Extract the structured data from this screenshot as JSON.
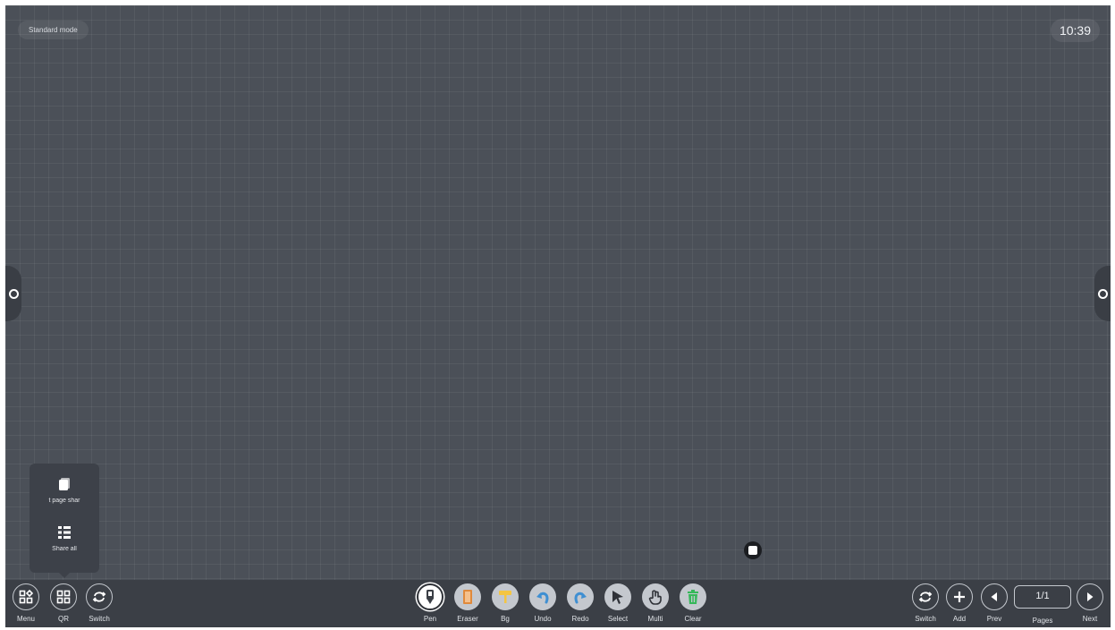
{
  "header": {
    "mode_label": "Standard mode",
    "clock": "10:39"
  },
  "share_popup": {
    "items": [
      {
        "icon": "copy-pages-icon",
        "label": "t page shar"
      },
      {
        "icon": "share-all-icon",
        "label": "Share all"
      }
    ]
  },
  "left_tools": [
    {
      "icon": "menu-grid-icon",
      "label": "Menu"
    },
    {
      "icon": "qr-code-icon",
      "label": "QR"
    },
    {
      "icon": "switch-icon",
      "label": "Switch"
    }
  ],
  "main_tools": [
    {
      "icon": "pen-icon",
      "label": "Pen",
      "color": "#ffffff",
      "selected": true
    },
    {
      "icon": "eraser-icon",
      "label": "Eraser",
      "color": "#f0b27a"
    },
    {
      "icon": "background-roller-icon",
      "label": "Bg",
      "color": "#f4c542"
    },
    {
      "icon": "undo-icon",
      "label": "Undo",
      "color": "#5aa9e6"
    },
    {
      "icon": "redo-icon",
      "label": "Redo",
      "color": "#5aa9e6"
    },
    {
      "icon": "select-cursor-icon",
      "label": "Select",
      "color": "#9aa0a8"
    },
    {
      "icon": "multi-touch-hand-icon",
      "label": "Multi",
      "color": "#9aa0a8"
    },
    {
      "icon": "trash-clear-icon",
      "label": "Clear",
      "color": "#43c463"
    }
  ],
  "right_tools": [
    {
      "icon": "switch-icon",
      "label": "Switch"
    },
    {
      "icon": "add-page-icon",
      "label": "Add"
    },
    {
      "icon": "prev-page-icon",
      "label": "Prev"
    },
    {
      "icon": "next-page-icon",
      "label": "Next"
    }
  ],
  "pages": {
    "value": "1/1",
    "label": "Pages"
  }
}
